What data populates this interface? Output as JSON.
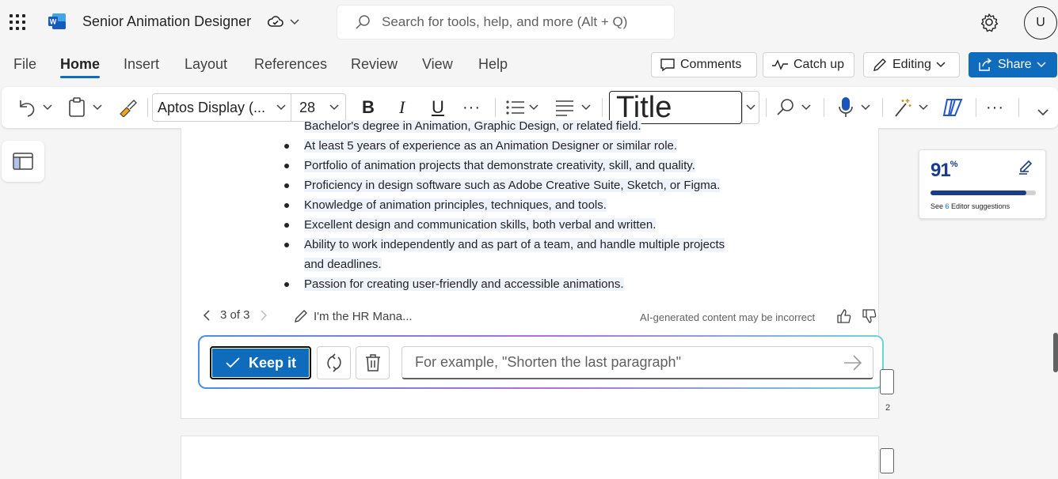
{
  "app": {
    "doc_title": "Senior Animation Designer",
    "search_placeholder": "Search for tools, help, and more (Alt + Q)",
    "avatar_initial": "U"
  },
  "ribbon": {
    "tabs": [
      "File",
      "Home",
      "Insert",
      "Layout",
      "References",
      "Review",
      "View",
      "Help"
    ],
    "active_tab": "Home",
    "comments_label": "Comments",
    "catchup_label": "Catch up",
    "editing_label": "Editing",
    "share_label": "Share"
  },
  "toolbar": {
    "font_name": "Aptos Display (...",
    "font_size": "28",
    "bold": "B",
    "italic": "I",
    "underline": "U",
    "style_name": "Title"
  },
  "document": {
    "bullets": [
      "Bachelor's degree in Animation, Graphic Design, or related field.",
      "At least 5 years of experience as an Animation Designer or similar role.",
      "Portfolio of animation projects that demonstrate creativity, skill, and quality.",
      "Proficiency in design software such as Adobe Creative Suite, Sketch, or Figma.",
      "Knowledge of animation principles, techniques, and tools.",
      "Excellent design and communication skills, both verbal and written.",
      "Ability to work independently and as part of a team, and handle multiple projects",
      "and deadlines.",
      "Passion for creating user-friendly and accessible animations."
    ],
    "page_number": "2"
  },
  "copilot": {
    "pager": "3 of 3",
    "prompt_preview": "I'm the HR Mana...",
    "disclaimer": "AI-generated content may be incorrect",
    "keep_label": "Keep it",
    "input_placeholder": "For example, \"Shorten the last paragraph\""
  },
  "editor": {
    "score": "91",
    "score_unit": "%",
    "score_fraction": 0.91,
    "suggestions_prefix": "See ",
    "suggestions_count": "6",
    "suggestions_suffix": " Editor suggestions"
  },
  "colors": {
    "accent": "#0f6cbd",
    "score": "#1a3a8a"
  }
}
